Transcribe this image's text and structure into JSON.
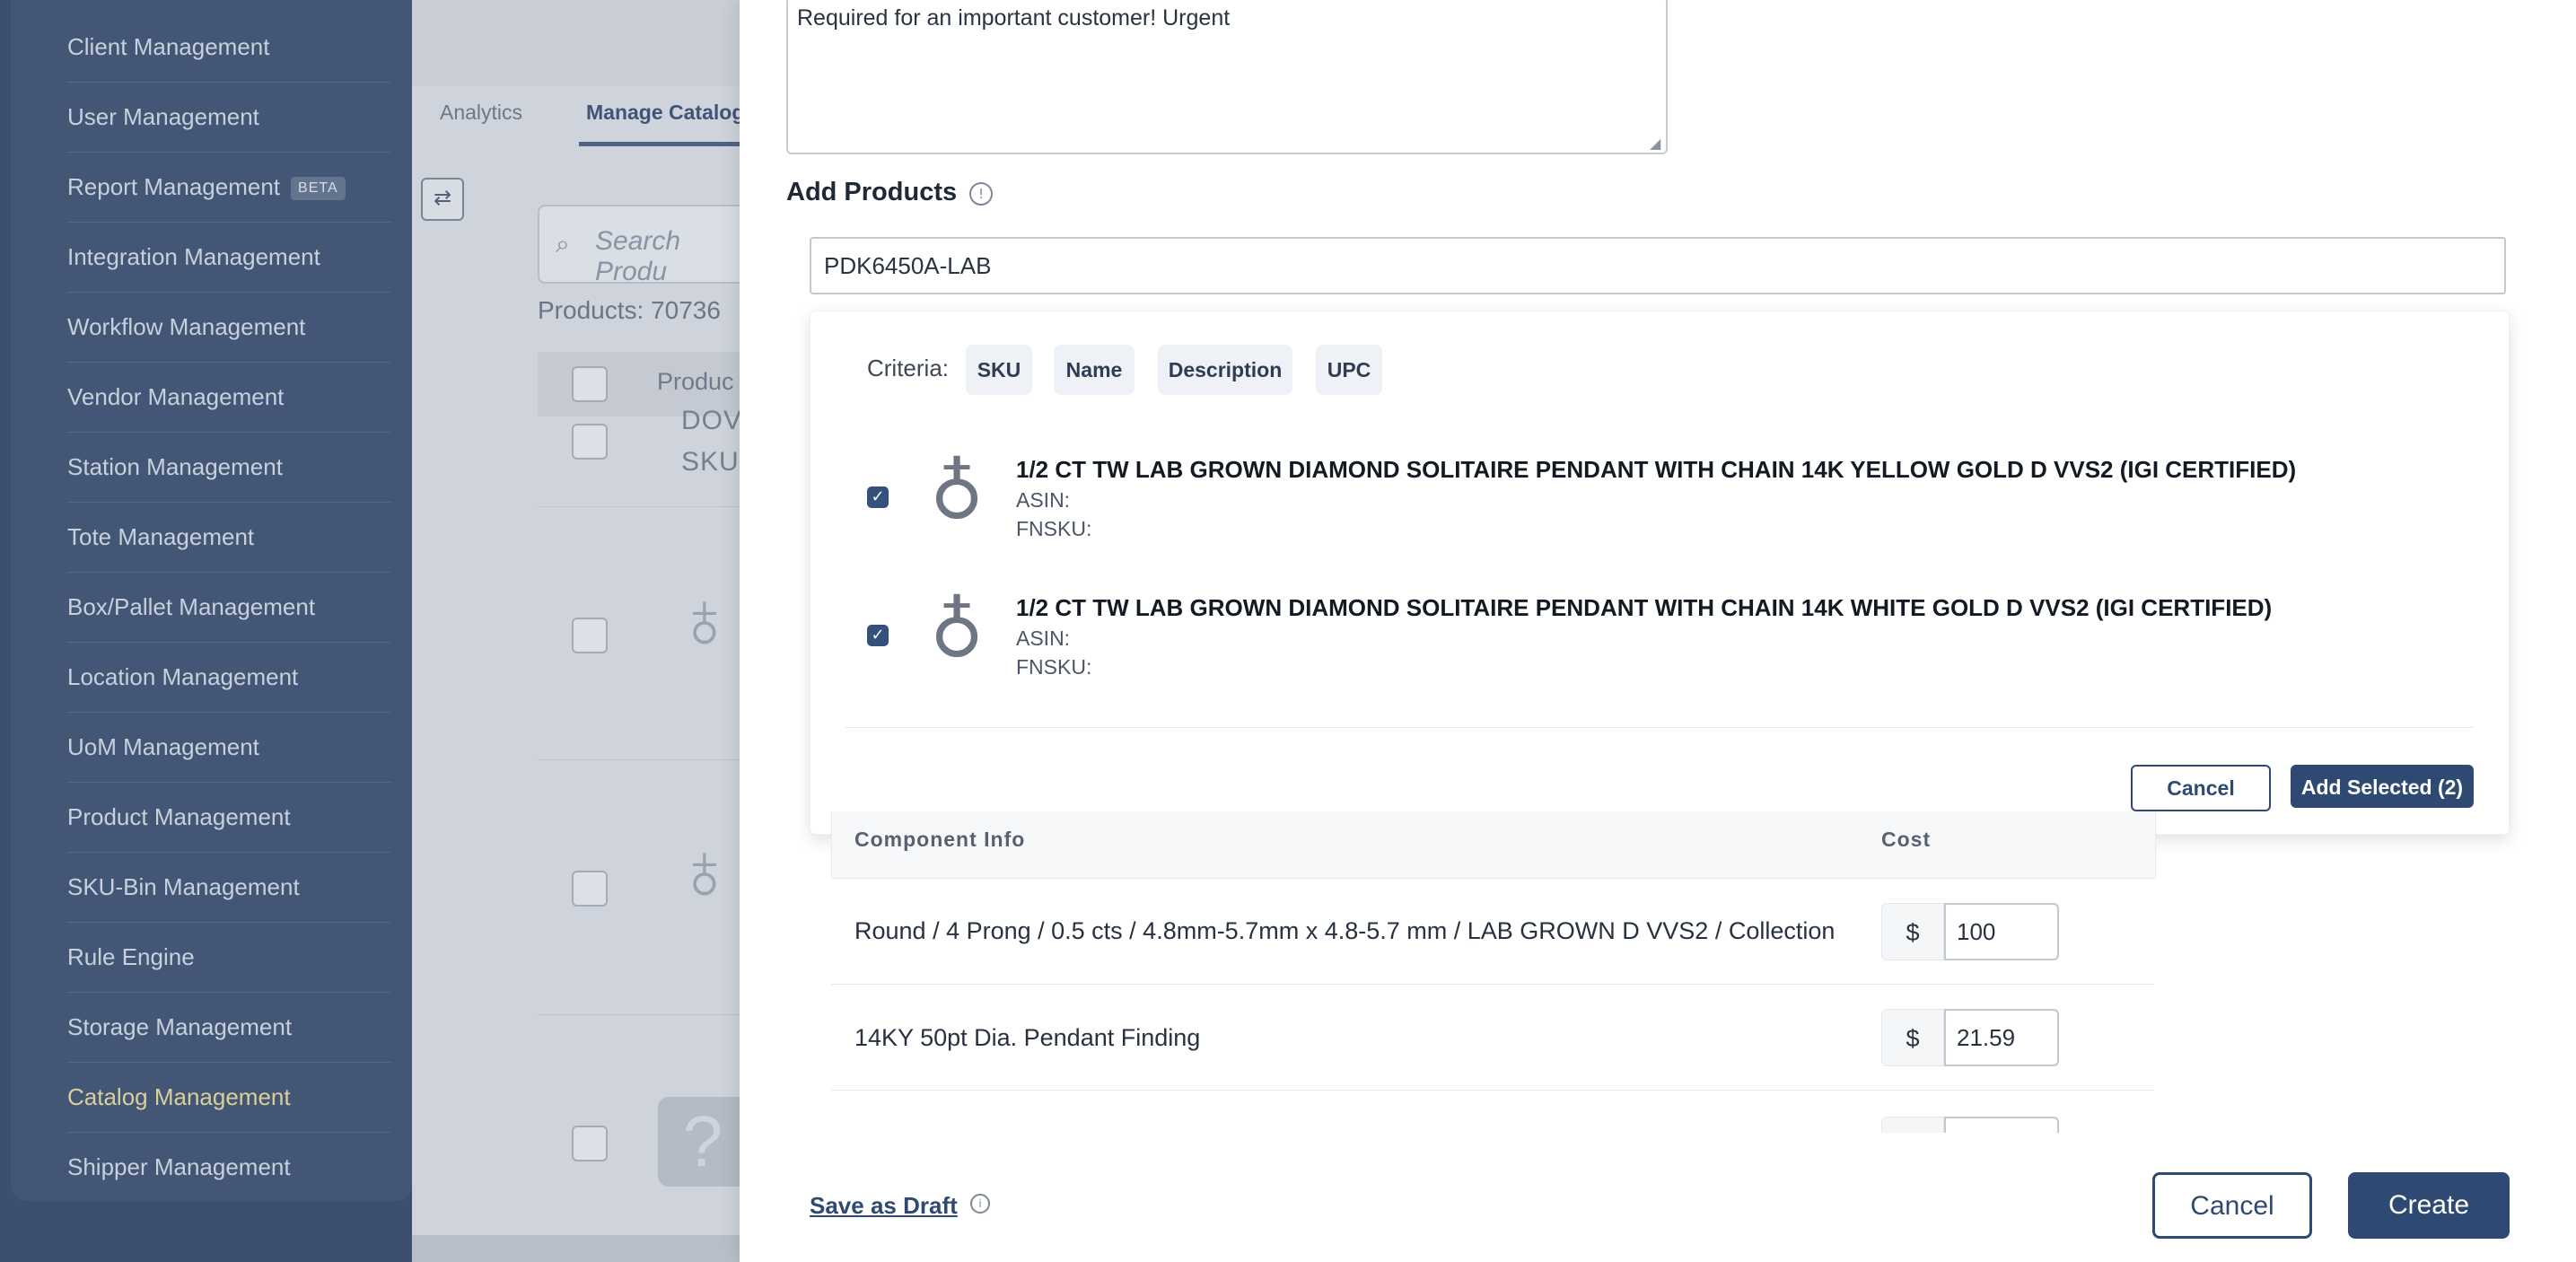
{
  "sidebar": {
    "items": [
      {
        "label": "Client Management"
      },
      {
        "label": "User Management"
      },
      {
        "label": "Report Management",
        "badge": "BETA"
      },
      {
        "label": "Integration Management"
      },
      {
        "label": "Workflow Management"
      },
      {
        "label": "Vendor Management"
      },
      {
        "label": "Station Management"
      },
      {
        "label": "Tote Management"
      },
      {
        "label": "Box/Pallet Management"
      },
      {
        "label": "Location Management"
      },
      {
        "label": "UoM Management"
      },
      {
        "label": "Product Management"
      },
      {
        "label": "SKU-Bin Management"
      },
      {
        "label": "Rule Engine"
      },
      {
        "label": "Storage Management"
      },
      {
        "label": "Catalog Management",
        "active": true
      },
      {
        "label": "Shipper Management"
      }
    ]
  },
  "background": {
    "tabs": [
      {
        "label": "Analytics"
      },
      {
        "label": "Manage Catalog"
      }
    ],
    "search_placeholder": "Search Produ",
    "products_count": "Products: 70736",
    "product_col": "Produc",
    "trunc_row_line1": "DOV",
    "trunc_row_line2": "SKU:"
  },
  "modal": {
    "notes_text": "Required for an important customer! Urgent",
    "add_products_label": "Add Products",
    "search_value": "PDK6450A-LAB",
    "criteria_label": "Criteria:",
    "criteria_chips": [
      "SKU",
      "Name",
      "Description",
      "UPC"
    ],
    "results": [
      {
        "title": "1/2 CT TW LAB GROWN DIAMOND SOLITAIRE PENDANT WITH CHAIN 14K YELLOW GOLD D VVS2 (IGI CERTIFIED)",
        "asin": "ASIN:",
        "fnsku": "FNSKU:",
        "checked": true
      },
      {
        "title": "1/2 CT TW LAB GROWN DIAMOND SOLITAIRE PENDANT WITH CHAIN 14K WHITE GOLD D VVS2 (IGI CERTIFIED)",
        "asin": "ASIN:",
        "fnsku": "FNSKU:",
        "checked": true
      }
    ],
    "dropdown_cancel": "Cancel",
    "add_selected": "Add Selected (2)",
    "component_table": {
      "headers": {
        "info": "Component Info",
        "cost": "Cost"
      },
      "rows": [
        {
          "info": "Round / 4 Prong / 0.5 cts / 4.8mm-5.7mm x 4.8-5.7 mm / LAB GROWN D VVS2 / Collection",
          "currency": "$",
          "cost": "100"
        },
        {
          "info": "14KY 50pt Dia. Pendant Finding",
          "currency": "$",
          "cost": "21.59"
        }
      ]
    },
    "save_draft": "Save as Draft",
    "cancel": "Cancel",
    "create": "Create"
  },
  "colors": {
    "sidebar_bg": "#435676",
    "primary": "#2f4a72",
    "active_nav": "#d9cf9b"
  }
}
